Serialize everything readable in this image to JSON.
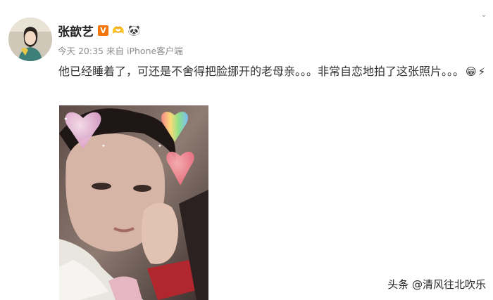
{
  "post": {
    "username": "张歆艺",
    "verified_badge": "V",
    "name_emojis": [
      "heart-hands-emoji",
      "panda-emoji"
    ],
    "time": "今天 20:35",
    "source_prefix": "来自",
    "source": "iPhone客户端",
    "text": "他已经睡着了，可还是不舍得把脸挪开的老母亲。。。非常自恋地拍了这张照片。。。",
    "text_emojis": [
      "grinning-face-emoji",
      "lightning-emoji"
    ]
  },
  "watermark": "头条 @清风往北吹乐",
  "colors": {
    "badge": "#f5740b",
    "username": "#222222",
    "meta": "#8c8c8c",
    "text": "#333333"
  }
}
